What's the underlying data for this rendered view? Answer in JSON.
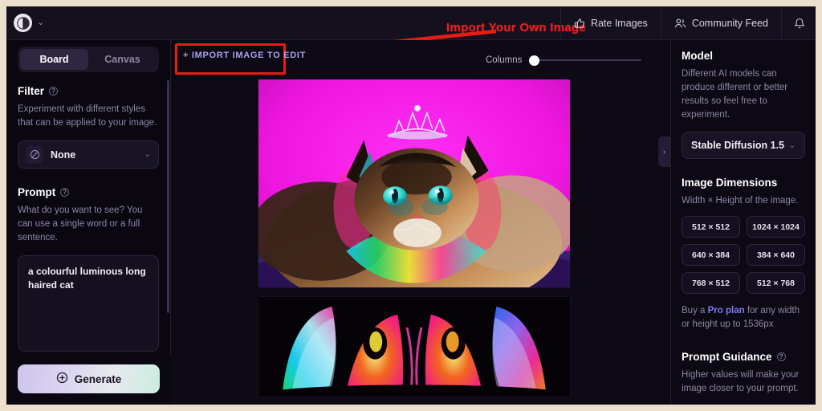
{
  "annotation": {
    "text": "Import Your Own Image",
    "color": "#e02020",
    "highlight_color": "#e81c14"
  },
  "topbar": {
    "logo_icon": "app-logo-icon",
    "logo_chevron": "⌄",
    "nav": [
      {
        "label": "Rate Images",
        "icon": "thumbs-up-icon"
      },
      {
        "label": "Community Feed",
        "icon": "people-icon"
      },
      {
        "label": "",
        "icon": "bell-icon"
      }
    ]
  },
  "sidebar": {
    "tabs": [
      {
        "label": "Board",
        "active": true
      },
      {
        "label": "Canvas",
        "active": false
      }
    ],
    "filter": {
      "title": "Filter",
      "help_icon": "question-icon",
      "description": "Experiment with different styles that can be applied to your image.",
      "selected": "None",
      "icon": "no-filter-icon",
      "chevron": "⌄"
    },
    "prompt": {
      "title": "Prompt",
      "help_icon": "question-icon",
      "description": "What do you want to see? You can use a single word or a full sentence.",
      "value": "a colourful luminous long haired cat",
      "placeholder": "What do you want to see?"
    },
    "generate": {
      "label": "Generate",
      "icon": "plus-circle-icon"
    }
  },
  "canvas": {
    "import_button": "+ IMPORT IMAGE TO EDIT",
    "columns_label": "Columns",
    "columns_value": 0,
    "collapse_icon": "chevron-right-icon",
    "images": [
      {
        "alt": "colourful luminous long haired cat wearing a tiara on magenta background"
      },
      {
        "alt": "neon glowing cat face on black background"
      }
    ]
  },
  "right_panel": {
    "model": {
      "title": "Model",
      "description": "Different AI models can produce different or better results so feel free to experiment.",
      "selected": "Stable Diffusion 1.5",
      "chevron": "⌄"
    },
    "dimensions": {
      "title": "Image Dimensions",
      "description": "Width × Height of the image.",
      "options": [
        "512 × 512",
        "1024 × 1024",
        "640 × 384",
        "384 × 640",
        "768 × 512",
        "512 × 768"
      ],
      "pro_note_before": "Buy a ",
      "pro_note_link": "Pro plan",
      "pro_note_after": " for any width or height up to 1536px"
    },
    "prompt_guidance": {
      "title": "Prompt Guidance",
      "help_icon": "question-icon",
      "description": "Higher values will make your image closer to your prompt."
    }
  }
}
